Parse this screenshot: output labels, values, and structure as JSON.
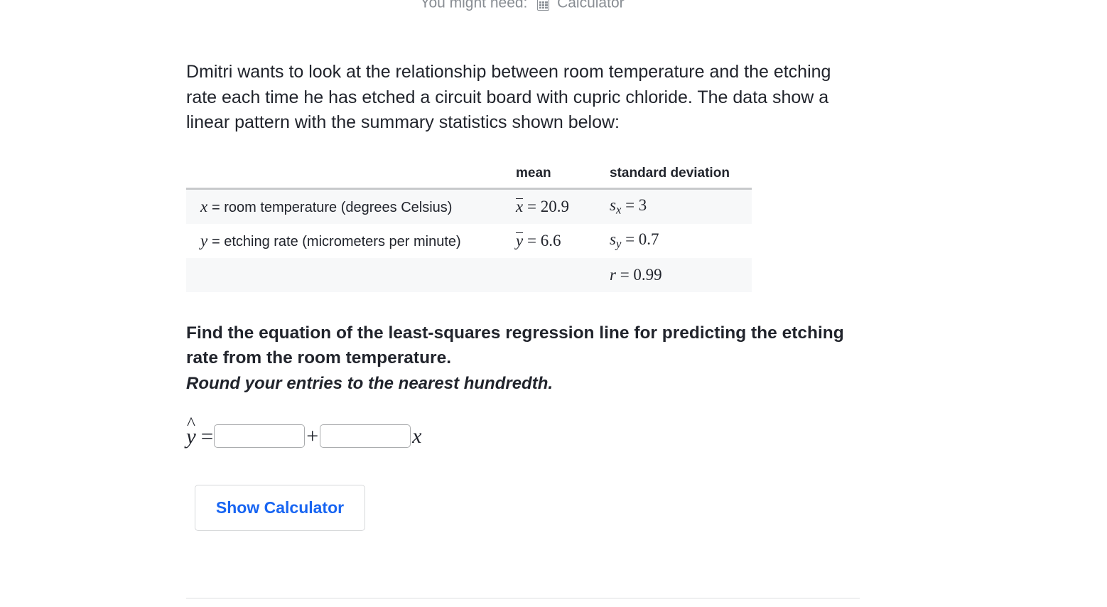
{
  "header": {
    "need_label": "You might need:",
    "calculator_word": "Calculator",
    "calculator_icon": "calculator-icon"
  },
  "prompt": {
    "text": "Dmitri wants to look at the relationship between room temperature and the etching rate each time he has etched a circuit board with cupric chloride. The data show a linear pattern with the summary statistics shown below:"
  },
  "table": {
    "headers": {
      "label": "",
      "mean": "mean",
      "sd": "standard deviation"
    },
    "rows": [
      {
        "var": "x",
        "var_desc": "= room temperature (degrees Celsius)",
        "mean_var": "x",
        "mean_value": "= 20.9",
        "sd_var": "s",
        "sd_sub": "x",
        "sd_value": "= 3"
      },
      {
        "var": "y",
        "var_desc": "= etching rate (micrometers per minute)",
        "mean_var": "y",
        "mean_value": "= 6.6",
        "sd_var": "s",
        "sd_sub": "y",
        "sd_value": "= 0.7"
      }
    ],
    "correlation": {
      "var": "r",
      "value": "= 0.99"
    }
  },
  "instruction": {
    "main": "Find the equation of the least-squares regression line for predicting the etching rate from the room temperature.",
    "note": "Round your entries to the nearest hundredth."
  },
  "answer": {
    "y_hat": "y",
    "equals": "=",
    "intercept_value": "",
    "intercept_placeholder": "",
    "plus": "+",
    "slope_value": "",
    "slope_placeholder": "",
    "x_variable": "x"
  },
  "buttons": {
    "show_calculator": "Show Calculator"
  },
  "colors": {
    "accent_blue": "#1865f2",
    "text": "#21242c",
    "muted": "#888d93",
    "row_shade": "#f7f8f9",
    "border": "#c8cacc"
  }
}
